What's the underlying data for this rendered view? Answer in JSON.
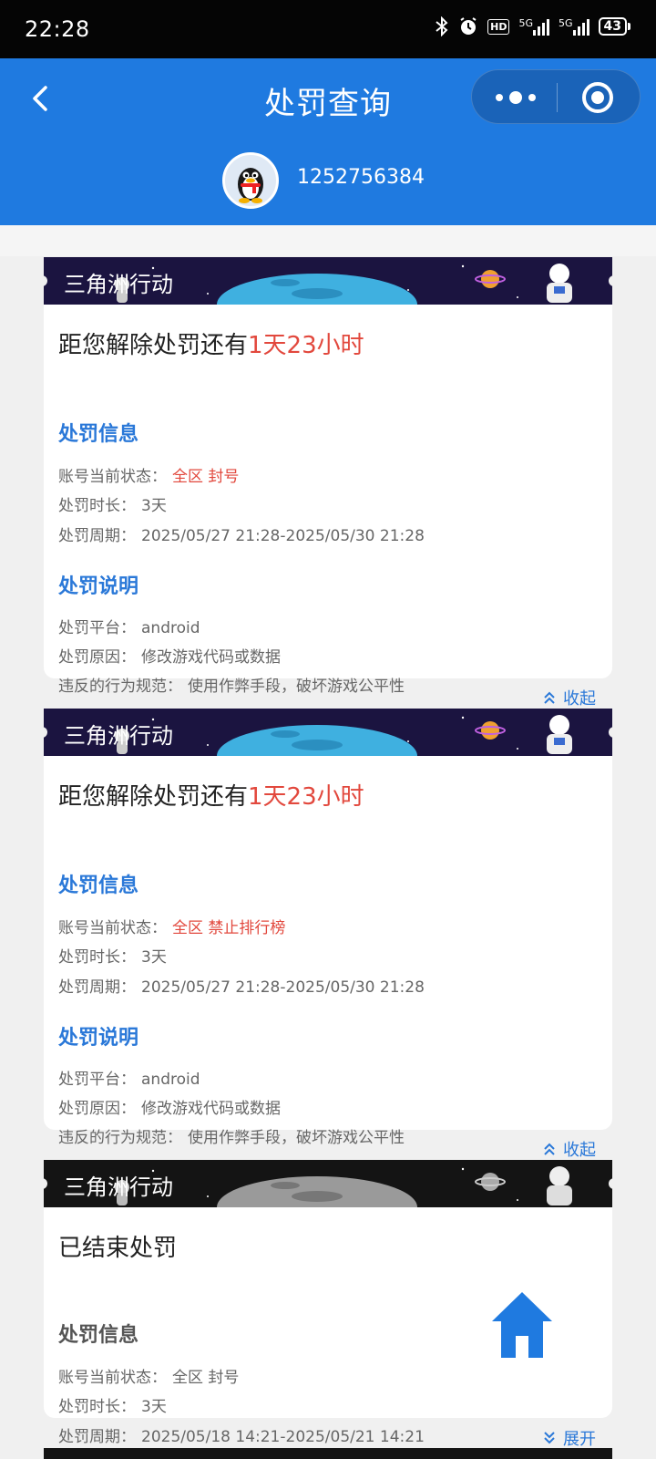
{
  "status_bar": {
    "time": "22:28",
    "icons": [
      "bluetooth-icon",
      "alarm-icon",
      "hd-icon",
      "5g-signal-icon",
      "5g-signal-icon"
    ],
    "hd_label": "HD",
    "network": "5G",
    "battery": "43"
  },
  "header": {
    "title": "处罚查询",
    "account": "1252756384",
    "colors": {
      "primary": "#1f7ae0",
      "capsule": "#1a63b8"
    }
  },
  "cards": [
    {
      "game": "三角洲行动",
      "countdown_prefix": "距您解除处罚还有",
      "countdown_value": "1天23小时",
      "info_title": "处罚信息",
      "status_label": "账号当前状态：",
      "status_value": "全区 封号",
      "duration_label": "处罚时长：",
      "duration_value": "3天",
      "period_label": "处罚周期：",
      "period_value": "2025/05/27 21:28-2025/05/30 21:28",
      "desc_title": "处罚说明",
      "platform_label": "处罚平台：",
      "platform_value": "android",
      "reason_label": "处罚原因：",
      "reason_value": "修改游戏代码或数据",
      "rule_label": "违反的行为规范：",
      "rule_value": "使用作弊手段，破坏游戏公平性",
      "toggle": "收起"
    },
    {
      "game": "三角洲行动",
      "countdown_prefix": "距您解除处罚还有",
      "countdown_value": "1天23小时",
      "info_title": "处罚信息",
      "status_label": "账号当前状态：",
      "status_value": "全区 禁止排行榜",
      "duration_label": "处罚时长：",
      "duration_value": "3天",
      "period_label": "处罚周期：",
      "period_value": "2025/05/27 21:28-2025/05/30 21:28",
      "desc_title": "处罚说明",
      "platform_label": "处罚平台：",
      "platform_value": "android",
      "reason_label": "处罚原因：",
      "reason_value": "修改游戏代码或数据",
      "rule_label": "违反的行为规范：",
      "rule_value": "使用作弊手段，破坏游戏公平性",
      "toggle": "收起"
    },
    {
      "game": "三角洲行动",
      "ended": "已结束处罚",
      "info_title": "处罚信息",
      "status_label": "账号当前状态：",
      "status_value": "全区 封号",
      "duration_label": "处罚时长：",
      "duration_value": "3天",
      "period_label": "处罚周期：",
      "period_value": "2025/05/18 14:21-2025/05/21 14:21",
      "toggle": "展开"
    }
  ],
  "colors": {
    "highlight_red": "#e2483d",
    "link_blue": "#2a78d8"
  }
}
